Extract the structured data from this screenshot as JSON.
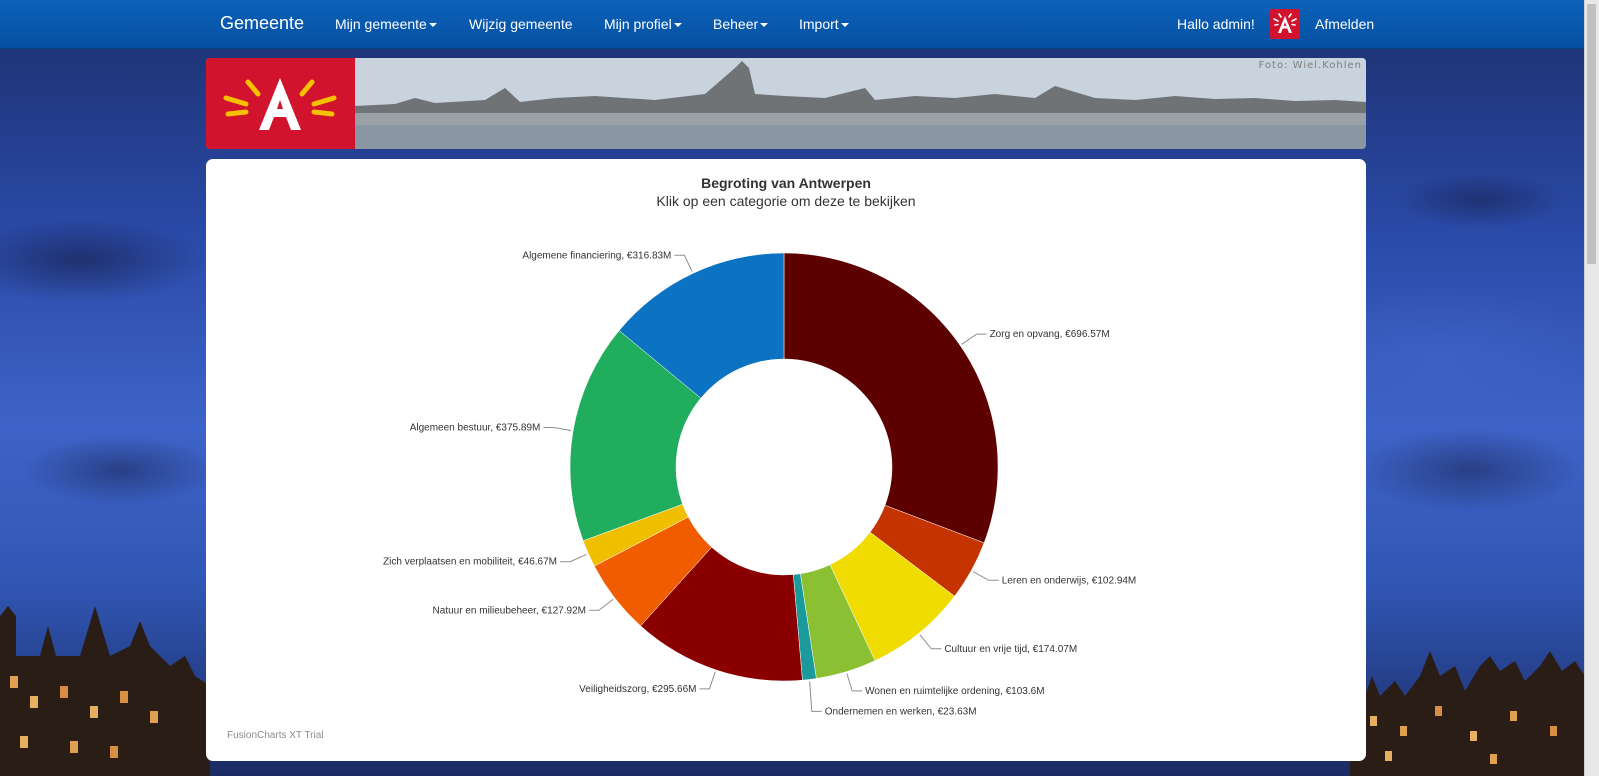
{
  "navbar": {
    "brand": "Gemeente",
    "items": [
      {
        "label": "Mijn gemeente",
        "dropdown": true
      },
      {
        "label": "Wijzig gemeente",
        "dropdown": false
      },
      {
        "label": "Mijn profiel",
        "dropdown": true
      },
      {
        "label": "Beheer",
        "dropdown": true
      },
      {
        "label": "Import",
        "dropdown": true
      }
    ],
    "greeting": "Hallo admin!",
    "logout": "Afmelden"
  },
  "banner": {
    "credit": "Foto: Wiel.Kohlen"
  },
  "chart_data": {
    "type": "pie",
    "variant": "doughnut",
    "title": "Begroting van Antwerpen",
    "subtitle": "Klik op een categorie om deze te bekijken",
    "watermark": "FusionCharts XT Trial",
    "slices": [
      {
        "label": "Zorg en opvang, €696.57M",
        "value": 696.57,
        "color": "#5c0000"
      },
      {
        "label": "Leren en onderwijs, €102.94M",
        "value": 102.94,
        "color": "#c43300"
      },
      {
        "label": "Cultuur en vrije tijd, €174.07M",
        "value": 174.07,
        "color": "#f0dc00"
      },
      {
        "label": "Wonen en ruimtelijke ordening, €103.6M",
        "value": 103.6,
        "color": "#8cc033"
      },
      {
        "label": "Ondernemen en werken, €23.63M",
        "value": 23.63,
        "color": "#1a9a9a"
      },
      {
        "label": "Veiligheidszorg, €295.66M",
        "value": 295.66,
        "color": "#8a0000"
      },
      {
        "label": "Natuur en milieubeheer, €127.92M",
        "value": 127.92,
        "color": "#f25c00"
      },
      {
        "label": "Zich verplaatsen en mobiliteit, €46.67M",
        "value": 46.67,
        "color": "#f0c000"
      },
      {
        "label": "Algemeen bestuur, €375.89M",
        "value": 375.89,
        "color": "#20ad5e"
      },
      {
        "label": "Algemene financiering, €316.83M",
        "value": 316.83,
        "color": "#0c72c2"
      }
    ]
  }
}
